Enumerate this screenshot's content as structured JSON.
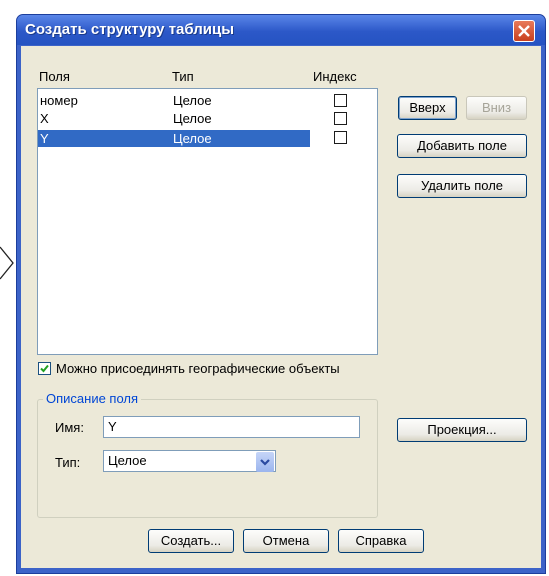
{
  "window": {
    "title": "Создать структуру таблицы"
  },
  "columns": {
    "field": "Поля",
    "type": "Тип",
    "index": "Индекс"
  },
  "fields": [
    {
      "name": "номер",
      "type": "Целое",
      "indexed": false,
      "selected": false
    },
    {
      "name": "X",
      "type": "Целое",
      "indexed": false,
      "selected": false
    },
    {
      "name": "Y",
      "type": "Целое",
      "indexed": false,
      "selected": true
    }
  ],
  "buttons": {
    "up": "Вверх",
    "down": "Вниз",
    "add": "Добавить поле",
    "remove": "Удалить поле",
    "projection": "Проекция...",
    "create": "Создать...",
    "cancel": "Отмена",
    "help": "Справка"
  },
  "geo_checkbox": {
    "label": "Можно присоединять географические объекты",
    "checked": true
  },
  "field_description": {
    "title": "Описание поля",
    "name_label": "Имя:",
    "name_value": "Y",
    "type_label": "Тип:",
    "type_value": "Целое"
  },
  "icons": {
    "close": "close-icon",
    "dropdown": "chevron-down-icon",
    "check": "checkmark-icon"
  },
  "colors": {
    "title_bar": "#2c58c8",
    "selection": "#316ac5",
    "dialog_bg": "#ece9d8"
  }
}
